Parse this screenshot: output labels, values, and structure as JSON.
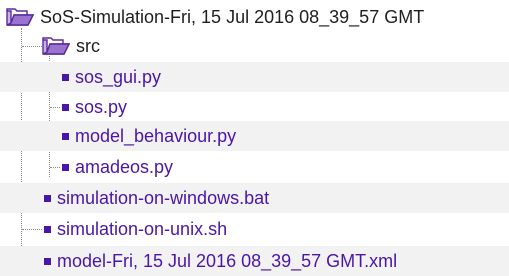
{
  "tree": {
    "root": {
      "label": "SoS-Simulation-Fri, 15 Jul 2016 08_39_57 GMT",
      "icon": "folder-open-icon"
    },
    "src_folder": {
      "label": "src",
      "icon": "folder-open-icon",
      "children": [
        {
          "label": "sos_gui.py",
          "icon": "file-bullet-icon"
        },
        {
          "label": "sos.py",
          "icon": "file-bullet-icon"
        },
        {
          "label": "model_behaviour.py",
          "icon": "file-bullet-icon"
        },
        {
          "label": "amadeos.py",
          "icon": "file-bullet-icon"
        }
      ]
    },
    "root_files": [
      {
        "label": "simulation-on-windows.bat",
        "icon": "file-bullet-icon"
      },
      {
        "label": "simulation-on-unix.sh",
        "icon": "file-bullet-icon"
      },
      {
        "label": "model-Fri, 15 Jul 2016 08_39_57 GMT.xml",
        "icon": "file-bullet-icon"
      }
    ]
  },
  "colors": {
    "file_text": "#4b16a8",
    "folder_text": "#1f1f1f",
    "folder_icon": "#7a4fb3",
    "guide_line": "#8a8a8a"
  }
}
